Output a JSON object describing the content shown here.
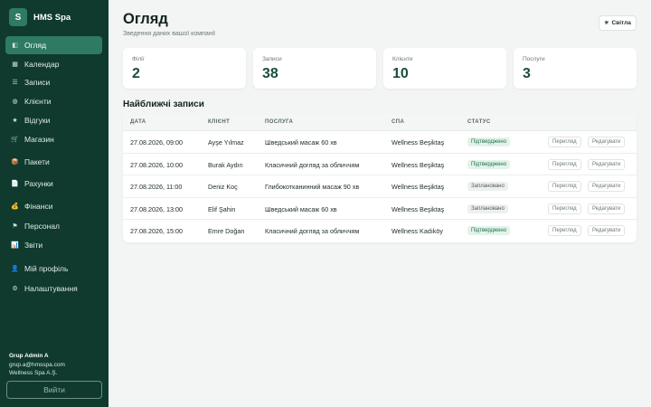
{
  "brand": {
    "logo_letter": "S",
    "name": "HMS Spa"
  },
  "nav": [
    {
      "label": "Огляд",
      "icon": "overview-icon",
      "glyph": "◧",
      "active": true
    },
    {
      "label": "Календар",
      "icon": "calendar-icon",
      "glyph": "▦"
    },
    {
      "label": "Записи",
      "icon": "list-icon",
      "glyph": "☰"
    },
    {
      "label": "Клієнти",
      "icon": "clients-icon",
      "glyph": "◍"
    },
    {
      "label": "Відгуки",
      "icon": "star-icon",
      "glyph": "★"
    },
    {
      "label": "Магазин",
      "icon": "cart-icon",
      "glyph": "🛒"
    },
    {
      "label": "Пакети",
      "icon": "package-icon",
      "glyph": "📦"
    },
    {
      "label": "Рахунки",
      "icon": "invoice-icon",
      "glyph": "📄"
    },
    {
      "label": "Фінанси",
      "icon": "money-bag-icon",
      "glyph": "💰"
    },
    {
      "label": "Персонал",
      "icon": "flag-icon",
      "glyph": "⚑"
    },
    {
      "label": "Звіти",
      "icon": "chart-icon",
      "glyph": "📊"
    },
    {
      "label": "Мій профіль",
      "icon": "user-icon",
      "glyph": "👤"
    },
    {
      "label": "Налаштування",
      "icon": "gear-icon",
      "glyph": "⚙"
    }
  ],
  "user": {
    "name": "Grup Admin A",
    "email": "grup.a@hmsspa.com",
    "company": "Wellness Spa A.Ş.",
    "logout_label": "Вийти"
  },
  "header": {
    "title": "Огляд",
    "subtitle": "Зведення даних вашої компанії",
    "theme_label": "Світла",
    "theme_icon": "sun-icon"
  },
  "stats": [
    {
      "label": "Філії",
      "value": "2"
    },
    {
      "label": "Записи",
      "value": "38"
    },
    {
      "label": "Клієнти",
      "value": "10"
    },
    {
      "label": "Послуги",
      "value": "3"
    }
  ],
  "appointments": {
    "title": "Найближчі записи",
    "columns": [
      "ДАТА",
      "КЛІЄНТ",
      "ПОСЛУГА",
      "СПА",
      "СТАТУС"
    ],
    "view_label": "Перегляд",
    "edit_label": "Редагувати",
    "rows": [
      {
        "date": "27.08.2026, 09:00",
        "client": "Ayşe Yılmaz",
        "service": "Шведський масаж 60 хв",
        "spa": "Wellness Beşiktaş",
        "status": "Підтверджено",
        "status_type": "confirmed"
      },
      {
        "date": "27.08.2026, 10:00",
        "client": "Burak Aydın",
        "service": "Класичний догляд за обличчям",
        "spa": "Wellness Beşiktaş",
        "status": "Підтверджено",
        "status_type": "confirmed"
      },
      {
        "date": "27.08.2026, 11:00",
        "client": "Deniz Koç",
        "service": "Глибокотканинний масаж 90 хв",
        "spa": "Wellness Beşiktaş",
        "status": "Заплановано",
        "status_type": "planned"
      },
      {
        "date": "27.08.2026, 13:00",
        "client": "Elif Şahin",
        "service": "Шведський масаж 60 хв",
        "spa": "Wellness Beşiktaş",
        "status": "Заплановано",
        "status_type": "planned"
      },
      {
        "date": "27.08.2026, 15:00",
        "client": "Emre Doğan",
        "service": "Класичний догляд за обличчям",
        "spa": "Wellness Kadıköy",
        "status": "Підтверджено",
        "status_type": "confirmed"
      }
    ]
  },
  "colors": {
    "sidebar_bg": "#0f3a2d",
    "accent": "#2e7a63",
    "confirmed_bg": "#e3f3ea",
    "confirmed_text": "#1f6d4b"
  }
}
